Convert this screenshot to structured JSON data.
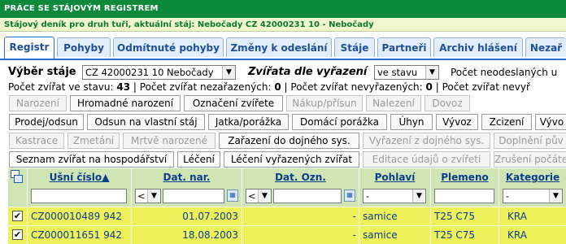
{
  "header": {
    "title": "Práce se stájovým registrem",
    "subtitle": "Stájový deník pro druh tuři, aktuální stáj: Nebočady CZ 42000231 10 - Nebočady"
  },
  "tabs": [
    "Registr",
    "Pohyby",
    "Odmítnuté pohyby",
    "Změny k odeslání",
    "Stáje",
    "Partneři",
    "Archiv hlášení",
    "Nezař"
  ],
  "active_tab": "Registr",
  "filters": {
    "stable_label": "Výběr stáje",
    "stable_value": "CZ 42000231 10 Nebočady",
    "animals_label": "Zvířata dle vyřazení",
    "animals_value": "ve stavu",
    "unsent_text": "Počet neodeslaných u"
  },
  "counts": {
    "in_stock_label": "Počet zvířat ve stavu:",
    "in_stock_value": "43",
    "sep1": " | ",
    "unassigned_label": "Počet zvířat nezařazených:",
    "unassigned_value": "0",
    "sep2": " | ",
    "unremoved_label": "Počet zvířat nevyřazených:",
    "unremoved_value": "0",
    "sep3": " | Počet zvířat nevyř"
  },
  "buttons": {
    "row1": [
      "Narození",
      "Hromadné narození",
      "Označení zvířete",
      "Nákup/přísun",
      "Nalezení",
      "Dovoz"
    ],
    "row2": [
      "Prodej/odsun",
      "Odsun na vlastní stáj",
      "Jatka/porážka",
      "Domácí porážka",
      "Úhyn",
      "Vývoz",
      "Zcizení",
      "Vývo"
    ],
    "row3": [
      "Kastrace",
      "Zmetání",
      "Mrtvě narozené",
      "Zařazení do dojného sys.",
      "Vyřazení z dojného sys.",
      "Doplnění pův"
    ],
    "row4": [
      "Seznam zvířat na hospodářství",
      "Léčení",
      "Léčení vyřazených zvířat",
      "Editace údajů o zvířeti",
      "Zrušení počáte"
    ]
  },
  "table": {
    "columns": [
      "Ušní číslo▲",
      "Dat. nar.",
      "Dat. Ozn.",
      "Pohlaví",
      "Plemeno",
      "Kategorie"
    ],
    "operator_symbol": "<",
    "rows": [
      {
        "ear": "CZ000010489 942",
        "birth": "01.07.2003",
        "marked": "-",
        "sex": "samice",
        "breed": "T25 C75",
        "cat": "KRA"
      },
      {
        "ear": "CZ000011651 942",
        "birth": "18.08.2003",
        "marked": "-",
        "sex": "samice",
        "breed": "T25 C75",
        "cat": "KRA"
      }
    ],
    "select_dash": "-"
  }
}
